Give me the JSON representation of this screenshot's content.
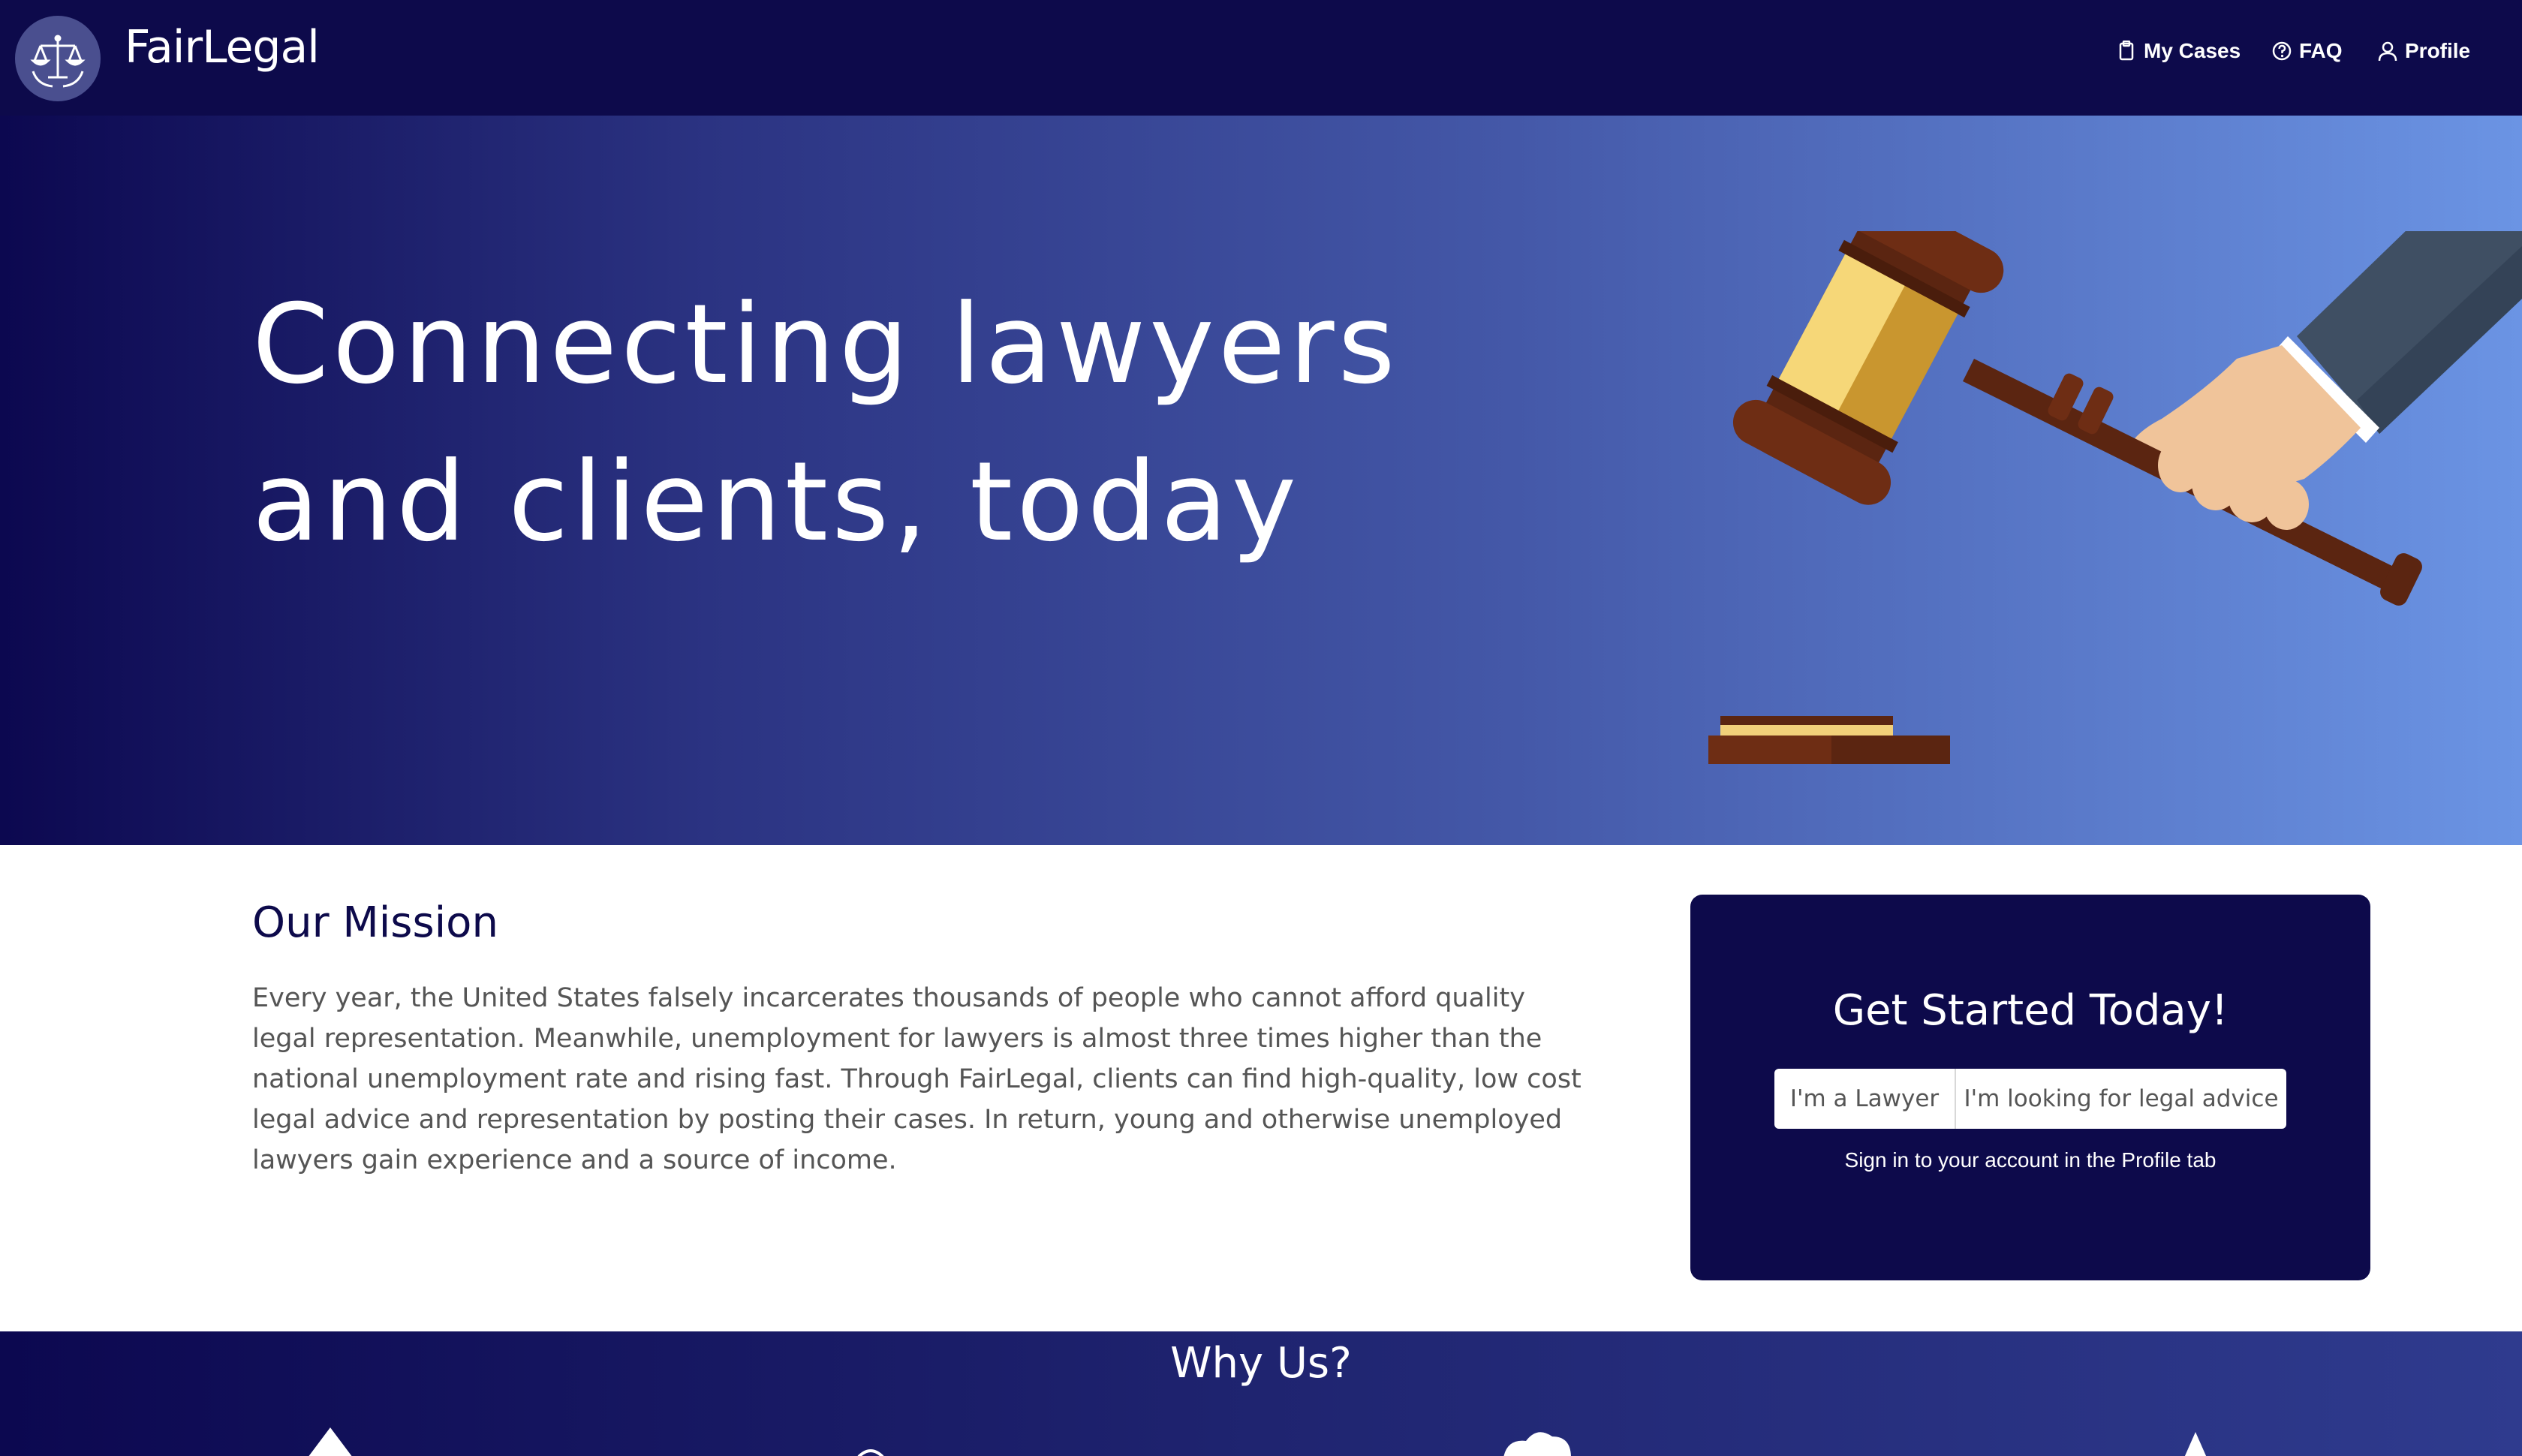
{
  "navbar": {
    "brand": "FairLegal",
    "items": [
      {
        "label": "My Cases",
        "icon": "clipboard-icon"
      },
      {
        "label": "FAQ",
        "icon": "question-circle-icon"
      },
      {
        "label": "Profile",
        "icon": "person-icon"
      }
    ]
  },
  "hero": {
    "title": "Connecting lawyers and clients, today"
  },
  "mission": {
    "title": "Our Mission",
    "text": "Every year, the United States falsely incarcerates thousands of people who cannot afford quality legal representation. Meanwhile, unemployment for lawyers is almost three times higher than the national unemployment rate and rising fast. Through FairLegal, clients can find high-quality, low cost legal advice and representation by posting their cases. In return, young and otherwise unemployed lawyers gain experience and a source of income."
  },
  "get_started": {
    "title": "Get Started Today!",
    "lawyer_button": "I'm a Lawyer",
    "client_button": "I'm looking for legal advice",
    "note": "Sign in to your account in the Profile tab"
  },
  "why_us": {
    "title": "Why Us?"
  },
  "colors": {
    "navy": "#0d0a4b",
    "hero_gradient_start": "#0c0850",
    "hero_gradient_end": "#6b94e4"
  }
}
